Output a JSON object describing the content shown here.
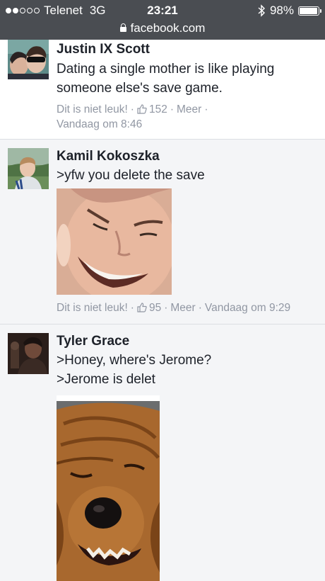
{
  "status_bar": {
    "carrier": "Telenet",
    "network": "3G",
    "time": "23:21",
    "battery": "98%",
    "battery_level": 0.98,
    "signal_bars_filled": 2,
    "signal_bars_total": 5
  },
  "url_bar": {
    "domain": "facebook.com"
  },
  "comments": [
    {
      "author": "Justin IX Scott",
      "lines": [
        "Dating a single mother is like playing",
        "someone else's save game."
      ],
      "unlike": "Dit is niet leuk!",
      "likes": "152",
      "more": "Meer",
      "time": "Vandaag om 8:46"
    },
    {
      "author": "Kamil Kokoszka",
      "lines": [
        ">yfw you delete the save"
      ],
      "unlike": "Dit is niet leuk!",
      "likes": "95",
      "more": "Meer",
      "time": "Vandaag om 9:29"
    },
    {
      "author": "Tyler Grace",
      "lines": [
        ">Honey, where's Jerome?",
        ">Jerome is delet"
      ]
    }
  ],
  "colors": {
    "status_bar_bg": "#4a4d52",
    "meta_text": "#9197a3",
    "first_comment_bg": "#ffffff",
    "page_bg": "#f4f5f7"
  }
}
